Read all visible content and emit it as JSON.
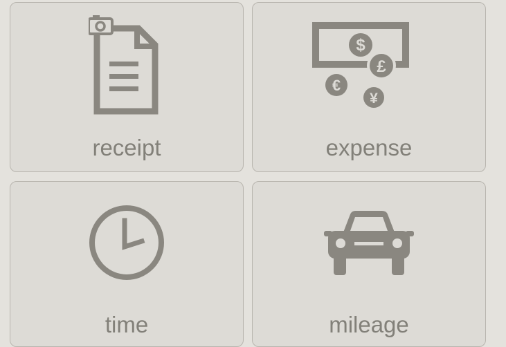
{
  "tiles": {
    "receipt": {
      "label": "receipt",
      "icon": "receipt-icon"
    },
    "expense": {
      "label": "expense",
      "icon": "money-currency-icon"
    },
    "time": {
      "label": "time",
      "icon": "clock-icon"
    },
    "mileage": {
      "label": "mileage",
      "icon": "car-icon"
    }
  },
  "currency_symbols": {
    "dollar": "$",
    "pound": "£",
    "euro": "€",
    "yen": "¥"
  },
  "colors": {
    "icon": "#8a8780",
    "label": "#828079",
    "tile_bg": "#dddbd6",
    "page_bg": "#e4e2dd"
  }
}
